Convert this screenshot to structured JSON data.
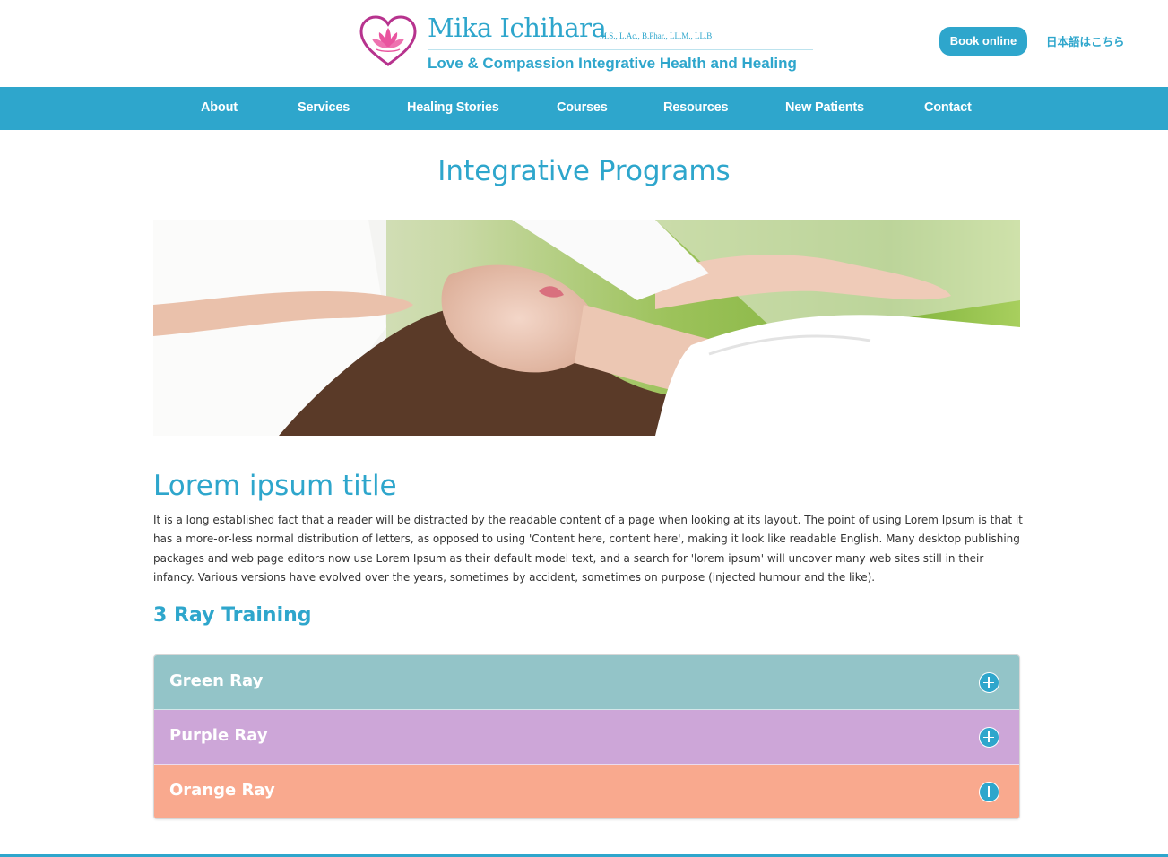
{
  "header": {
    "brand_name": "Mika Ichihara",
    "brand_credentials": "M.S., L.Ac., B.Phar., LL.M., LL.B",
    "tagline": "Love & Compassion Integrative Health and Healing",
    "book_button": "Book online",
    "language_link": "日本語はこちら",
    "logo_icon": "lotus-heart-icon"
  },
  "nav": {
    "items": [
      {
        "label": "About"
      },
      {
        "label": "Services"
      },
      {
        "label": "Healing Stories"
      },
      {
        "label": "Courses"
      },
      {
        "label": "Resources"
      },
      {
        "label": "New Patients"
      },
      {
        "label": "Contact"
      }
    ]
  },
  "main": {
    "page_title": "Integrative Programs",
    "section_title": "Lorem ipsum title",
    "body_text": "It is a long established fact that a reader will be distracted by the readable content of a page when looking at its layout. The point of using Lorem Ipsum is that it has a more-or-less normal distribution of letters, as opposed to using 'Content here, content here', making it look like readable English. Many desktop publishing packages and web page editors now use Lorem Ipsum as their default model text, and a search for 'lorem ipsum' will uncover many web sites still in their infancy. Various versions have evolved over the years, sometimes by accident, sometimes on purpose (injected humour and the like).",
    "sub_title": "3 Ray Training",
    "accordion": [
      {
        "label": "Green Ray",
        "color": "#93c4c8",
        "icon": "plus-circle-icon"
      },
      {
        "label": "Purple Ray",
        "color": "#cda6d8",
        "icon": "plus-circle-icon"
      },
      {
        "label": "Orange Ray",
        "color": "#f9a98e",
        "icon": "plus-circle-icon"
      }
    ]
  },
  "colors": {
    "brand_primary": "#2ea6cc",
    "logo_heart": "#b7338e",
    "logo_lotus": "#e9549f"
  }
}
